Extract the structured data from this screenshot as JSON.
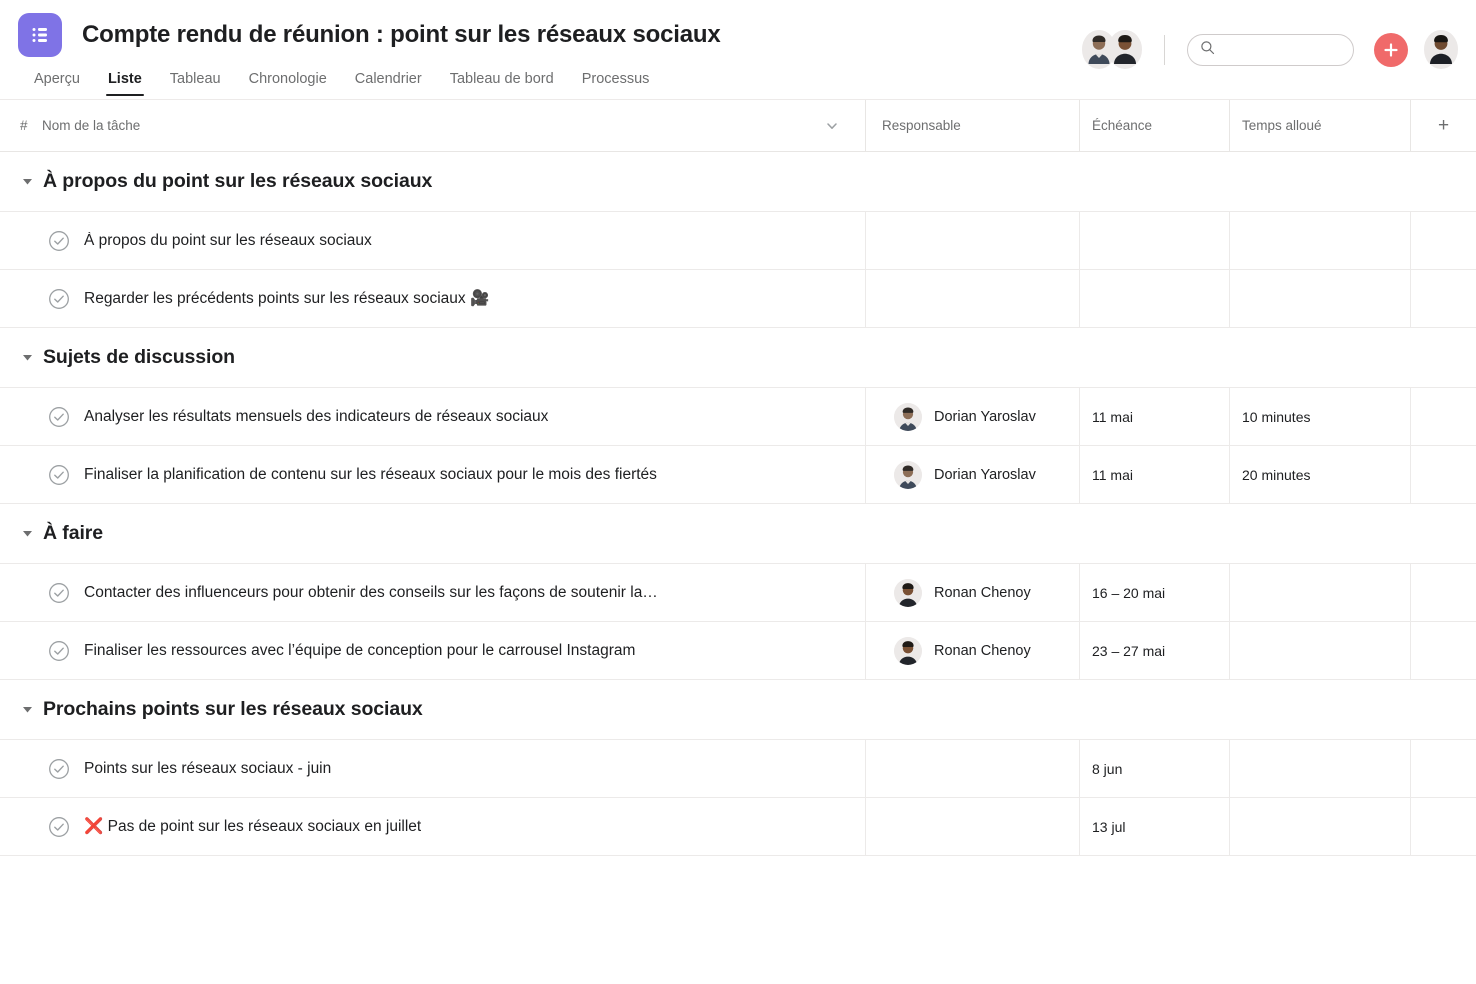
{
  "header": {
    "app_icon": "list-icon",
    "title": "Compte rendu de réunion : point sur les réseaux sociaux",
    "accent_purple": "#7f73e6",
    "accent_red": "#f06a6a",
    "tabs": [
      {
        "label": "Aperçu",
        "active": false
      },
      {
        "label": "Liste",
        "active": true
      },
      {
        "label": "Tableau",
        "active": false
      },
      {
        "label": "Chronologie",
        "active": false
      },
      {
        "label": "Calendrier",
        "active": false
      },
      {
        "label": "Tableau de bord",
        "active": false
      },
      {
        "label": "Processus",
        "active": false
      }
    ],
    "search": {
      "value": "",
      "placeholder": ""
    },
    "add_button_label": "+"
  },
  "columns": {
    "number": "#",
    "task_name": "Nom de la tâche",
    "assignee": "Responsable",
    "due_date": "Échéance",
    "time_allocated": "Temps alloué",
    "add_column": "+"
  },
  "sections": [
    {
      "title": "À propos du point sur les réseaux sociaux",
      "rows": [
        {
          "task": "À propos du point sur les réseaux sociaux",
          "assignee": "",
          "due": "",
          "time": ""
        },
        {
          "task": "Regarder les précédents points sur les réseaux sociaux 🎥",
          "assignee": "",
          "due": "",
          "time": ""
        }
      ]
    },
    {
      "title": "Sujets de discussion",
      "rows": [
        {
          "task": "Analyser les résultats mensuels des indicateurs de réseaux sociaux",
          "assignee": "Dorian Yaroslav",
          "due": "11 mai",
          "time": "10 minutes"
        },
        {
          "task": "Finaliser la planification de contenu sur les réseaux sociaux pour le mois des fiertés",
          "assignee": "Dorian Yaroslav",
          "due": "11 mai",
          "time": "20 minutes"
        }
      ]
    },
    {
      "title": "À faire",
      "rows": [
        {
          "task": "Contacter des influenceurs pour obtenir des conseils sur les façons de soutenir la…",
          "assignee": "Ronan Chenoy",
          "due": "16 – 20 mai",
          "time": ""
        },
        {
          "task": "Finaliser les ressources avec l’équipe de conception pour le carrousel Instagram",
          "assignee": "Ronan Chenoy",
          "due": "23 – 27 mai",
          "time": ""
        }
      ]
    },
    {
      "title": "Prochains points sur les réseaux sociaux",
      "rows": [
        {
          "task": "Points sur les réseaux sociaux - juin",
          "assignee": "",
          "due": "8 jun",
          "time": ""
        },
        {
          "task": "❌ Pas de point sur les réseaux sociaux en juillet",
          "assignee": "",
          "due": "13 jul",
          "time": ""
        }
      ]
    }
  ]
}
